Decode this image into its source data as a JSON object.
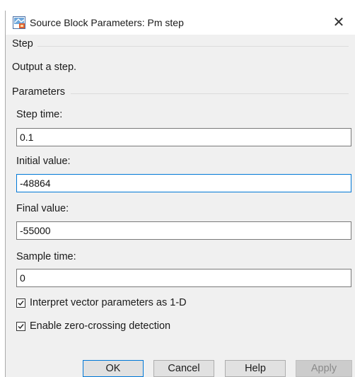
{
  "window": {
    "title": "Source Block Parameters: Pm step",
    "close_glyph": "✕",
    "icon": "simulink-block-icon",
    "close_icon": "close-icon"
  },
  "block": {
    "group_title": "Step",
    "description": "Output a step."
  },
  "parameters": {
    "group_title": "Parameters",
    "step_time": {
      "label": "Step time:",
      "value": "0.1"
    },
    "initial_value": {
      "label": "Initial value:",
      "value": "-48864"
    },
    "final_value": {
      "label": "Final value:",
      "value": "-55000"
    },
    "sample_time": {
      "label": "Sample time:",
      "value": "0"
    },
    "interpret_vector": {
      "label": "Interpret vector parameters as 1-D",
      "checked": true
    },
    "zero_crossing": {
      "label": "Enable zero-crossing detection",
      "checked": true
    }
  },
  "buttons": {
    "ok": "OK",
    "cancel": "Cancel",
    "help": "Help",
    "apply": "Apply"
  },
  "colors": {
    "focus_border": "#0078d7",
    "dialog_bg": "#f0f0f0"
  }
}
